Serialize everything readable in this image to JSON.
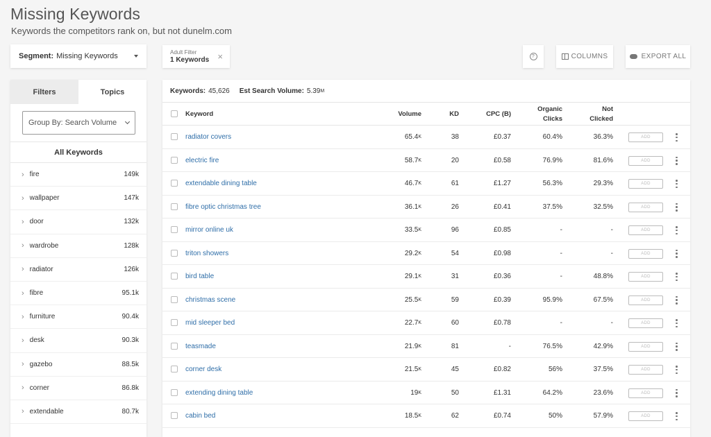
{
  "page": {
    "title": "Missing Keywords",
    "subtitle": "Keywords the competitors rank on, but not dunelm.com"
  },
  "segment": {
    "label": "Segment:",
    "value": "Missing Keywords"
  },
  "filter_chip": {
    "label": "Adult Filter",
    "value": "1 Keywords"
  },
  "toolbar": {
    "help": "?",
    "columns": "COLUMNS",
    "export": "EXPORT ALL"
  },
  "sidebar": {
    "tabs": [
      "Filters",
      "Topics"
    ],
    "active_tab": "Topics",
    "group_by": "Group By: Search Volume",
    "all_keywords": "All Keywords",
    "topics": [
      {
        "name": "fire",
        "count": "149k"
      },
      {
        "name": "wallpaper",
        "count": "147k"
      },
      {
        "name": "door",
        "count": "132k"
      },
      {
        "name": "wardrobe",
        "count": "128k"
      },
      {
        "name": "radiator",
        "count": "126k"
      },
      {
        "name": "fibre",
        "count": "95.1k"
      },
      {
        "name": "furniture",
        "count": "90.4k"
      },
      {
        "name": "desk",
        "count": "90.3k"
      },
      {
        "name": "gazebo",
        "count": "88.5k"
      },
      {
        "name": "corner",
        "count": "86.8k"
      },
      {
        "name": "extendable",
        "count": "80.7k"
      }
    ]
  },
  "summary": {
    "keywords_label": "Keywords:",
    "keywords_value": "45,626",
    "volume_label": "Est Search Volume:",
    "volume_value": "5.39",
    "volume_unit": "M"
  },
  "table": {
    "headers": {
      "keyword": "Keyword",
      "volume": "Volume",
      "kd": "KD",
      "cpc": "CPC (B)",
      "organic": [
        "Organic",
        "Clicks"
      ],
      "not_clicked": [
        "Not",
        "Clicked"
      ]
    },
    "add_label": "ADD",
    "rows": [
      {
        "keyword": "radiator covers",
        "volume": "65.4",
        "unit": "K",
        "kd": "38",
        "cpc": "£0.37",
        "organic": "60.4%",
        "not_clicked": "36.3%"
      },
      {
        "keyword": "electric fire",
        "volume": "58.7",
        "unit": "K",
        "kd": "20",
        "cpc": "£0.58",
        "organic": "76.9%",
        "not_clicked": "81.6%"
      },
      {
        "keyword": "extendable dining table",
        "volume": "46.7",
        "unit": "K",
        "kd": "61",
        "cpc": "£1.27",
        "organic": "56.3%",
        "not_clicked": "29.3%"
      },
      {
        "keyword": "fibre optic christmas tree",
        "volume": "36.1",
        "unit": "K",
        "kd": "26",
        "cpc": "£0.41",
        "organic": "37.5%",
        "not_clicked": "32.5%"
      },
      {
        "keyword": "mirror online uk",
        "volume": "33.5",
        "unit": "K",
        "kd": "96",
        "cpc": "£0.85",
        "organic": "-",
        "not_clicked": "-"
      },
      {
        "keyword": "triton showers",
        "volume": "29.2",
        "unit": "K",
        "kd": "54",
        "cpc": "£0.98",
        "organic": "-",
        "not_clicked": "-"
      },
      {
        "keyword": "bird table",
        "volume": "29.1",
        "unit": "K",
        "kd": "31",
        "cpc": "£0.36",
        "organic": "-",
        "not_clicked": "48.8%"
      },
      {
        "keyword": "christmas scene",
        "volume": "25.5",
        "unit": "K",
        "kd": "59",
        "cpc": "£0.39",
        "organic": "95.9%",
        "not_clicked": "67.5%"
      },
      {
        "keyword": "mid sleeper bed",
        "volume": "22.7",
        "unit": "K",
        "kd": "60",
        "cpc": "£0.78",
        "organic": "-",
        "not_clicked": "-"
      },
      {
        "keyword": "teasmade",
        "volume": "21.9",
        "unit": "K",
        "kd": "81",
        "cpc": "-",
        "organic": "76.5%",
        "not_clicked": "42.9%"
      },
      {
        "keyword": "corner desk",
        "volume": "21.5",
        "unit": "K",
        "kd": "45",
        "cpc": "£0.82",
        "organic": "56%",
        "not_clicked": "37.5%"
      },
      {
        "keyword": "extending dining table",
        "volume": "19",
        "unit": "K",
        "kd": "50",
        "cpc": "£1.31",
        "organic": "64.2%",
        "not_clicked": "23.6%"
      },
      {
        "keyword": "cabin bed",
        "volume": "18.5",
        "unit": "K",
        "kd": "62",
        "cpc": "£0.74",
        "organic": "50%",
        "not_clicked": "57.9%"
      }
    ]
  }
}
